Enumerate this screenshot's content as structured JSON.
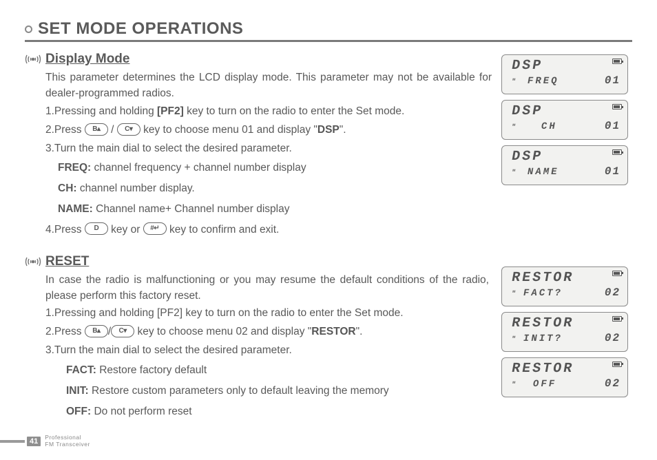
{
  "page_title": "SET MODE OPERATIONS",
  "sections": {
    "display": {
      "title": "Display Mode",
      "intro": "This parameter determines the LCD display mode. This parameter may not be available for dealer-programmed radios.",
      "step1_a": "1.Pressing and holding ",
      "pf2": "[PF2]",
      "step1_b": " key to turn on the radio to enter the Set mode.",
      "step2_a": "2.Press ",
      "step2_b": " / ",
      "step2_c": " key to choose menu 01 and display  \"",
      "dsp": "DSP",
      "step2_d": "\".",
      "step3": "3.Turn the main dial to select the desired parameter.",
      "freq_lbl": "FREQ:",
      "freq_txt": " channel frequency + channel number display",
      "ch_lbl": "CH:",
      "ch_txt": " channel number display.",
      "name_lbl": "NAME:",
      "name_txt": " Channel name+ Channel number display",
      "step4_a": "4.Press ",
      "step4_b": " key or ",
      "step4_c": " key to confirm and exit.",
      "lcds": [
        {
          "top": "DSP",
          "label": "FREQ",
          "num": "01"
        },
        {
          "top": "DSP",
          "label": "CH",
          "num": "01"
        },
        {
          "top": "DSP",
          "label": "NAME",
          "num": "01"
        }
      ]
    },
    "reset": {
      "title": "RESET",
      "intro": "In case the radio is malfunctioning or you may resume the default conditions of the radio, please perform this factory reset.",
      "step1": "1.Pressing and holding [PF2] key to turn on the radio to enter the Set mode.",
      "step2_a": "2.Press ",
      "step2_b": "/",
      "step2_c": " key to choose menu 02 and display \"",
      "restor": "RESTOR",
      "step2_d": "\".",
      "step3": "3.Turn the main dial to select the desired parameter.",
      "fact_lbl": "FACT:",
      "fact_txt": " Restore factory default",
      "init_lbl": "INIT:",
      "init_txt": " Restore custom parameters only to default leaving the memory",
      "off_lbl": "OFF:",
      "off_txt": " Do not perform reset",
      "lcds": [
        {
          "top": "RESTOR",
          "label": "FACT?",
          "num": "02"
        },
        {
          "top": "RESTOR",
          "label": "INIT?",
          "num": "02"
        },
        {
          "top": "RESTOR",
          "label": "OFF",
          "num": "02"
        }
      ]
    }
  },
  "keys": {
    "b": "B▴",
    "c": "C▾",
    "d": "D",
    "hash": "#↵"
  },
  "footer": {
    "page": "41",
    "line1": "Professional",
    "line2": "FM Transceiver"
  }
}
